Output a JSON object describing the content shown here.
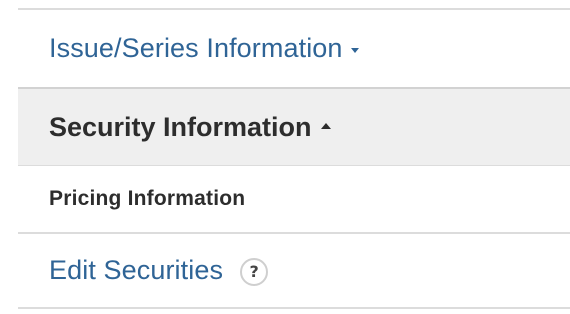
{
  "nav": {
    "items": [
      {
        "label": "Issue/Series Information",
        "state": "collapsed",
        "icon": "caret-down-icon"
      },
      {
        "label": "Security Information",
        "state": "expanded",
        "icon": "caret-up-icon"
      },
      {
        "label": "Pricing Information"
      },
      {
        "label": "Edit Securities",
        "help": "?"
      }
    ]
  },
  "colors": {
    "link": "#2f6496",
    "heading": "#2d2d2d",
    "active_background": "#efefef",
    "divider": "#dcdcdc"
  }
}
